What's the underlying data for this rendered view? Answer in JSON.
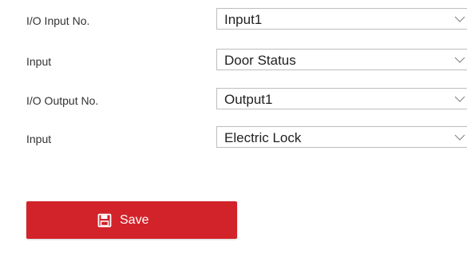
{
  "form": {
    "rows": [
      {
        "label": "I/O Input No.",
        "value": "Input1"
      },
      {
        "label": "Input",
        "value": "Door Status"
      },
      {
        "label": "I/O Output No.",
        "value": "Output1"
      },
      {
        "label": "Input",
        "value": "Electric Lock"
      }
    ]
  },
  "actions": {
    "save_label": "Save",
    "save_icon": "floppy-disk-icon",
    "save_color": "#d2232a"
  },
  "icons": {
    "dropdown": "chevron-down-icon"
  }
}
